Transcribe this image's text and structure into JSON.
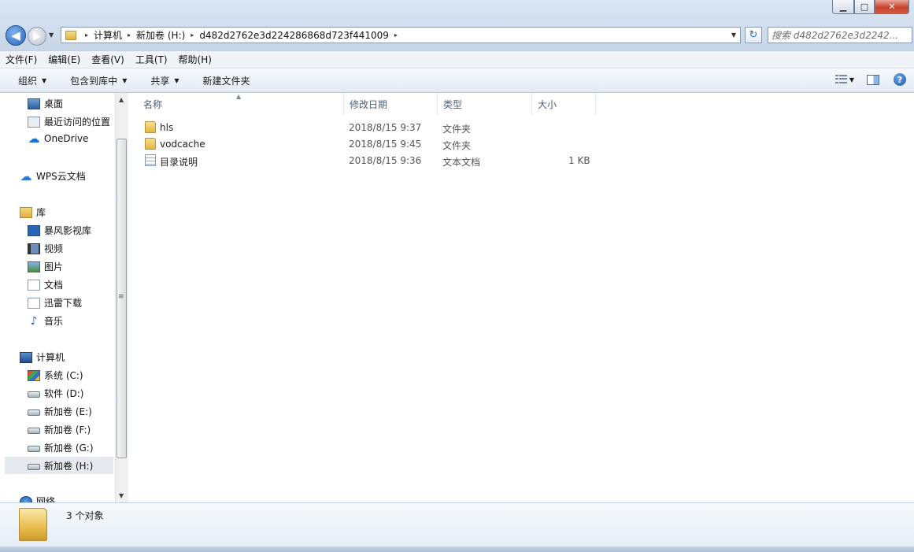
{
  "window": {
    "controls": {
      "minimize": "▁",
      "maximize": "□",
      "close": "✕"
    }
  },
  "address": {
    "back": "◀",
    "forward": "▶",
    "breadcrumbs": [
      "计算机",
      "新加卷 (H:)",
      "d482d2762e3d224286868d723f441009"
    ],
    "separator": "▸",
    "dropdown": "▼",
    "refresh": "↻"
  },
  "search": {
    "placeholder": "搜索 d482d2762e3d2242..."
  },
  "menubar": [
    "文件(F)",
    "编辑(E)",
    "查看(V)",
    "工具(T)",
    "帮助(H)"
  ],
  "toolbar": {
    "organize": "组织",
    "include_library": "包含到库中",
    "share": "共享",
    "new_folder": "新建文件夹",
    "dropdown_arrow": "▼",
    "help": "?"
  },
  "nav": {
    "desktop": "桌面",
    "recent": "最近访问的位置",
    "onedrive": "OneDrive",
    "wps": "WPS云文档",
    "libraries": "库",
    "baofeng": "暴风影视库",
    "videos": "视频",
    "pictures": "图片",
    "documents": "文档",
    "xunlei": "迅雷下载",
    "music": "音乐",
    "computer": "计算机",
    "drive_c": "系统 (C:)",
    "drive_d": "软件 (D:)",
    "drive_e": "新加卷 (E:)",
    "drive_f": "新加卷 (F:)",
    "drive_g": "新加卷 (G:)",
    "drive_h": "新加卷 (H:)",
    "network": "网络"
  },
  "columns": {
    "name": "名称",
    "date": "修改日期",
    "type": "类型",
    "size": "大小"
  },
  "files": [
    {
      "name": "hls",
      "date": "2018/8/15 9:37",
      "type": "文件夹",
      "size": "",
      "icon": "folder-icon"
    },
    {
      "name": "vodcache",
      "date": "2018/8/15 9:45",
      "type": "文件夹",
      "size": "",
      "icon": "folder-icon"
    },
    {
      "name": "目录说明",
      "date": "2018/8/15 9:36",
      "type": "文本文档",
      "size": "1 KB",
      "icon": "text-file-icon"
    }
  ],
  "status": {
    "item_count": "3 个对象"
  },
  "colors": {
    "accent": "#2a64b8",
    "window_frame": "#c8d7e8",
    "close_button": "#c8402b"
  }
}
